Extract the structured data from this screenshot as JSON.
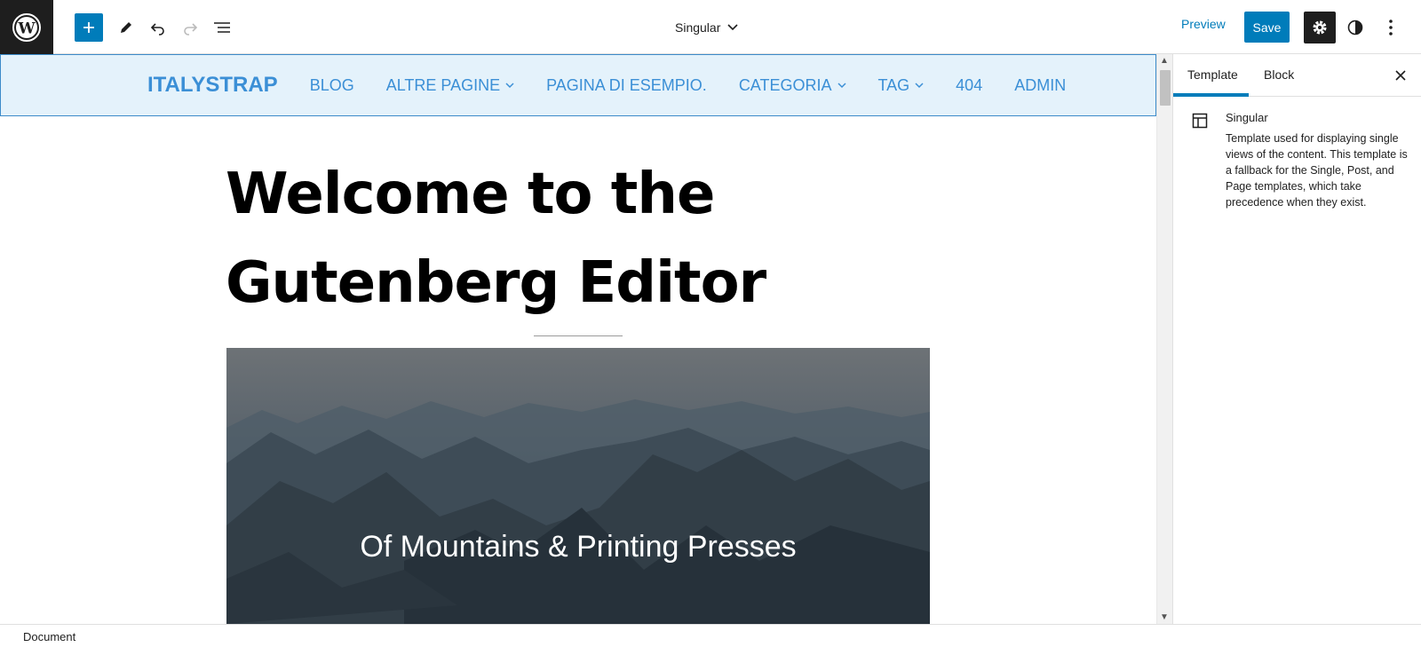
{
  "toolbar": {
    "document_title": "Singular",
    "preview_label": "Preview",
    "save_label": "Save"
  },
  "nav": {
    "site_title": "ITALYSTRAP",
    "items": [
      {
        "label": "BLOG",
        "has_submenu": false
      },
      {
        "label": "ALTRE PAGINE",
        "has_submenu": true
      },
      {
        "label": "PAGINA DI ESEMPIO.",
        "has_submenu": false
      },
      {
        "label": "CATEGORIA",
        "has_submenu": true
      },
      {
        "label": "TAG",
        "has_submenu": true
      },
      {
        "label": "404",
        "has_submenu": false
      },
      {
        "label": "ADMIN",
        "has_submenu": false
      }
    ]
  },
  "content": {
    "heading_line1": "Welcome to the",
    "heading_line2": "Gutenberg Editor",
    "cover_title": "Of Mountains & Printing Presses"
  },
  "sidebar": {
    "tabs": [
      "Template",
      "Block"
    ],
    "active_tab": "Template",
    "template_name": "Singular",
    "template_description": "Template used for displaying single views of the content. This template is a fallback for the Single, Post, and Page templates, which take precedence when they exist."
  },
  "footer": {
    "breadcrumb": "Document"
  },
  "colors": {
    "accent": "#007cba",
    "nav_link": "#3b8fd6",
    "nav_bg": "#e4f2fb",
    "dark": "#1e1e1e"
  }
}
